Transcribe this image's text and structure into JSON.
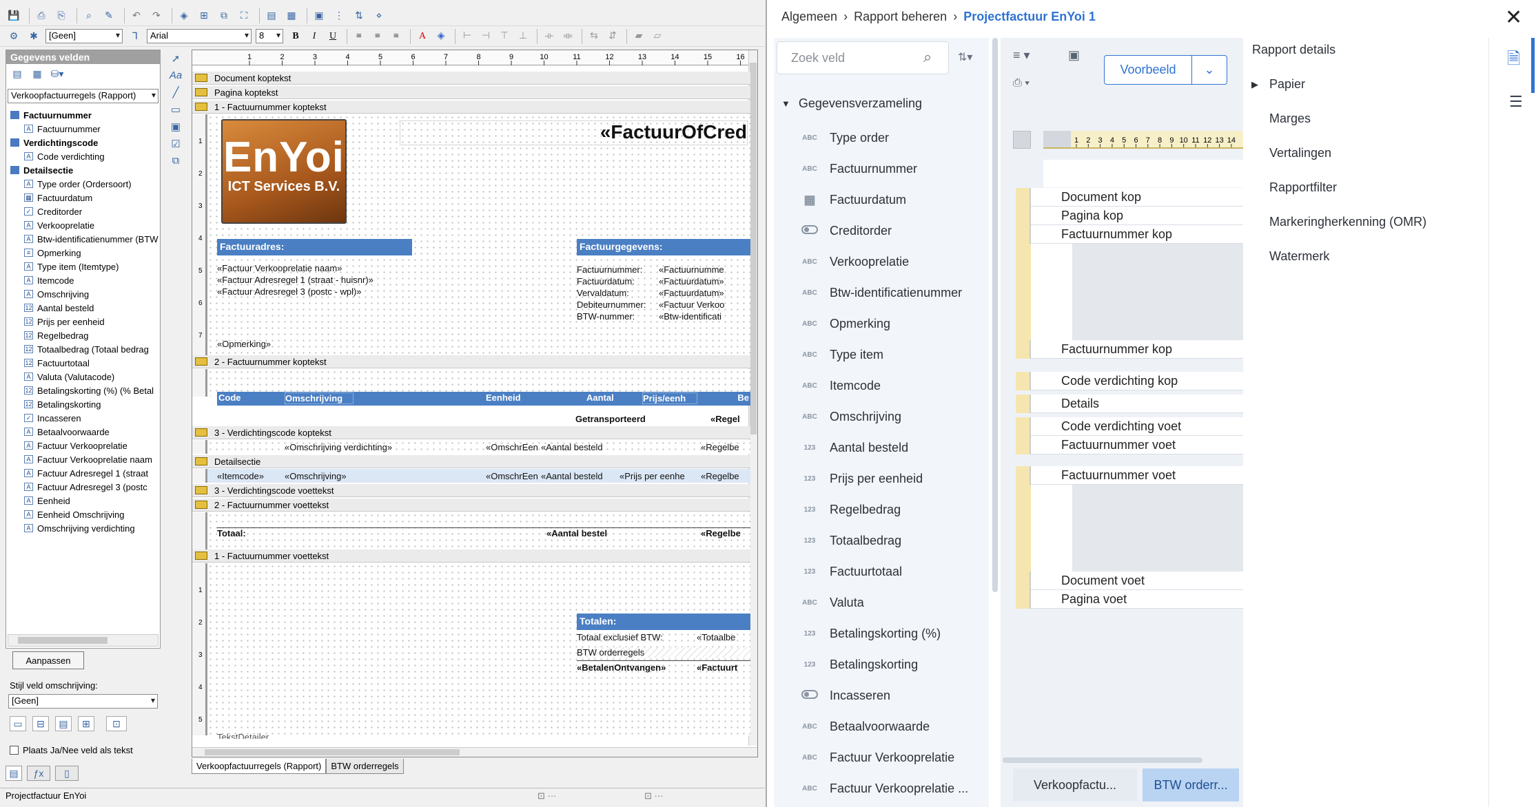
{
  "left": {
    "toolbar2": {
      "font_style": "[Geen]",
      "font_name": "Arial",
      "font_size": "8"
    },
    "fields_panel": {
      "title": "Gegevens velden",
      "source": "Verkoopfactuurregels (Rapport)"
    },
    "tree": [
      {
        "label": "Factuurnummer",
        "group": true
      },
      {
        "label": "Factuurnummer",
        "group": false,
        "icon": "A"
      },
      {
        "label": "Verdichtingscode",
        "group": true
      },
      {
        "label": "Code verdichting",
        "group": false,
        "icon": "A"
      },
      {
        "label": "Detailsectie",
        "group": true
      },
      {
        "label": "Type order (Ordersoort)",
        "group": false,
        "icon": "A"
      },
      {
        "label": "Factuurdatum",
        "group": false,
        "icon": "▦"
      },
      {
        "label": "Creditorder",
        "group": false,
        "icon": "✓"
      },
      {
        "label": "Verkooprelatie",
        "group": false,
        "icon": "A"
      },
      {
        "label": "Btw-identificatienummer (BTW",
        "group": false,
        "icon": "A"
      },
      {
        "label": "Opmerking",
        "group": false,
        "icon": "≡"
      },
      {
        "label": "Type item (Itemtype)",
        "group": false,
        "icon": "A"
      },
      {
        "label": "Itemcode",
        "group": false,
        "icon": "A"
      },
      {
        "label": "Omschrijving",
        "group": false,
        "icon": "A"
      },
      {
        "label": "Aantal besteld",
        "group": false,
        "icon": "12"
      },
      {
        "label": "Prijs per eenheid",
        "group": false,
        "icon": "12"
      },
      {
        "label": "Regelbedrag",
        "group": false,
        "icon": "12"
      },
      {
        "label": "Totaalbedrag (Totaal bedrag",
        "group": false,
        "icon": "12"
      },
      {
        "label": "Factuurtotaal",
        "group": false,
        "icon": "12"
      },
      {
        "label": "Valuta (Valutacode)",
        "group": false,
        "icon": "A"
      },
      {
        "label": "Betalingskorting (%) (% Betal",
        "group": false,
        "icon": "12"
      },
      {
        "label": "Betalingskorting",
        "group": false,
        "icon": "12"
      },
      {
        "label": "Incasseren",
        "group": false,
        "icon": "✓"
      },
      {
        "label": "Betaalvoorwaarde",
        "group": false,
        "icon": "A"
      },
      {
        "label": "Factuur Verkooprelatie",
        "group": false,
        "icon": "A"
      },
      {
        "label": "Factuur Verkooprelatie naam",
        "group": false,
        "icon": "A"
      },
      {
        "label": "Factuur Adresregel 1 (straat",
        "group": false,
        "icon": "A"
      },
      {
        "label": "Factuur Adresregel 3 (postc",
        "group": false,
        "icon": "A"
      },
      {
        "label": "Eenheid",
        "group": false,
        "icon": "A"
      },
      {
        "label": "Eenheid Omschrijving",
        "group": false,
        "icon": "A"
      },
      {
        "label": "Omschrijving verdichting",
        "group": false,
        "icon": "A"
      }
    ],
    "aanpassen": "Aanpassen",
    "stijl_label": "Stijl veld omschrijving:",
    "stijl_value": "[Geen]",
    "plaats_label": "Plaats Ja/Nee veld als tekst",
    "status": "Projectfactuur EnYoi",
    "bottom_tabs": [
      "Verkoopfactuurregels (Rapport)",
      "BTW orderregels"
    ],
    "ruler_numbers": [
      "1",
      "2",
      "3",
      "4",
      "5",
      "6",
      "7",
      "8",
      "9",
      "10",
      "11",
      "12",
      "13",
      "14",
      "15",
      "16"
    ],
    "bands": {
      "b1": "Document koptekst",
      "b2": "Pagina koptekst",
      "b3": "1 - Factuurnummer koptekst",
      "b4": "2 - Factuurnummer koptekst",
      "b5": "3 - Verdichtingscode koptekst",
      "b6": "Detailsectie",
      "b7": "3 - Verdichtingscode voettekst",
      "b8": "2 - Factuurnummer voettekst",
      "b9": "1 - Factuurnummer voettekst"
    },
    "logo": {
      "big": "EnYoi",
      "small": "ICT Services B.V."
    },
    "design": {
      "factuur_title": "«FactuurOfCred",
      "factuuradres": "Factuuradres:",
      "adres1": "«Factuur Verkooprelatie naam»",
      "adres2": "«Factuur Adresregel 1 (straat - huisnr)»",
      "adres3": "«Factuur Adresregel 3 (postc - wpl)»",
      "factuurgegevens": "Factuurgegevens:",
      "fg_labels": [
        "Factuurnummer:",
        "Factuurdatum:",
        "Vervaldatum:",
        "Debiteurnummer:",
        "BTW-nummer:"
      ],
      "fg_values": [
        "«Factuurnumme",
        "«Factuurdatum»",
        "«Factuurdatum»",
        "«Factuur Verkoo",
        "«Btw-identificati"
      ],
      "opmerking": "«Opmerking»",
      "col_headers": [
        "Code",
        "Omschrijving",
        "Eenheid",
        "Aantal",
        "Prijs/eenh",
        "Be"
      ],
      "getransporteerd": "Getransporteerd",
      "regel1": "«Regel",
      "verd_omschr": "«Omschrijving verdichting»",
      "verd_eenh": "«OmschrEen",
      "verd_aantal": "«Aantal besteld",
      "verd_regel": "«Regelbe",
      "det_itemcode": "«Itemcode»",
      "det_omschr": "«Omschrijving»",
      "det_eenh": "«OmschrEen",
      "det_aantal": "«Aantal besteld",
      "det_prijs": "«Prijs per eenhe",
      "det_regel": "«Regelbe",
      "totaal": "Totaal:",
      "tot_aantal": "«Aantal bestel",
      "tot_regel": "«Regelbe",
      "totalen": "Totalen:",
      "tot_excl": "Totaal exclusief BTW:",
      "tot_excl_val": "«Totaalbe",
      "btw_regels": "BTW orderregels",
      "betalen": "«BetalenOntvangen»",
      "betalen_val": "«Factuurt",
      "tekst_bottom": "TekstDetailer"
    },
    "vruler_a": [
      "1",
      "2",
      "3",
      "4",
      "5",
      "6",
      "7"
    ],
    "vruler_b": [
      "1",
      "2",
      "3",
      "4",
      "5"
    ]
  },
  "right": {
    "breadcrumb": {
      "a": "Algemeen",
      "sep": "›",
      "b": "Rapport beheren",
      "c": "Projectfactuur EnYoi 1"
    },
    "search_placeholder": "Zoek veld",
    "dataset_label": "Gegevensverzameling",
    "fields": [
      {
        "type": "ABC",
        "label": "Type order"
      },
      {
        "type": "ABC",
        "label": "Factuurnummer"
      },
      {
        "type": "cal",
        "label": "Factuurdatum"
      },
      {
        "type": "toggle",
        "label": "Creditorder"
      },
      {
        "type": "ABC",
        "label": "Verkooprelatie"
      },
      {
        "type": "ABC",
        "label": "Btw-identificatienummer"
      },
      {
        "type": "ABC",
        "label": "Opmerking"
      },
      {
        "type": "ABC",
        "label": "Type item"
      },
      {
        "type": "ABC",
        "label": "Itemcode"
      },
      {
        "type": "ABC",
        "label": "Omschrijving"
      },
      {
        "type": "123",
        "label": "Aantal besteld"
      },
      {
        "type": "123",
        "label": "Prijs per eenheid"
      },
      {
        "type": "123",
        "label": "Regelbedrag"
      },
      {
        "type": "123",
        "label": "Totaalbedrag"
      },
      {
        "type": "123",
        "label": "Factuurtotaal"
      },
      {
        "type": "ABC",
        "label": "Valuta"
      },
      {
        "type": "123",
        "label": "Betalingskorting (%)"
      },
      {
        "type": "123",
        "label": "Betalingskorting"
      },
      {
        "type": "toggle",
        "label": "Incasseren"
      },
      {
        "type": "ABC",
        "label": "Betaalvoorwaarde"
      },
      {
        "type": "ABC",
        "label": "Factuur Verkooprelatie"
      },
      {
        "type": "ABC",
        "label": "Factuur Verkooprelatie ..."
      }
    ],
    "voorbeeld": "Voorbeeld",
    "preview_ruler": [
      "1",
      "2",
      "3",
      "4",
      "5",
      "6",
      "7",
      "8",
      "9",
      "10",
      "11",
      "12",
      "13",
      "14"
    ],
    "preview_rows": [
      "Document kop",
      "Pagina kop",
      "Factuurnummer kop",
      "Factuurnummer kop",
      "Code verdichting kop",
      "Details",
      "Code verdichting voet",
      "Factuurnummer voet",
      "Factuurnummer voet",
      "Document voet",
      "Pagina voet"
    ],
    "preview_tabs": [
      "Verkoopfactu...",
      "BTW orderr..."
    ],
    "details_title": "Rapport details",
    "details": [
      "Papier",
      "Marges",
      "Vertalingen",
      "Rapportfilter",
      "Markeringherkenning (OMR)",
      "Watermerk"
    ],
    "accent": "#2f73d3"
  }
}
